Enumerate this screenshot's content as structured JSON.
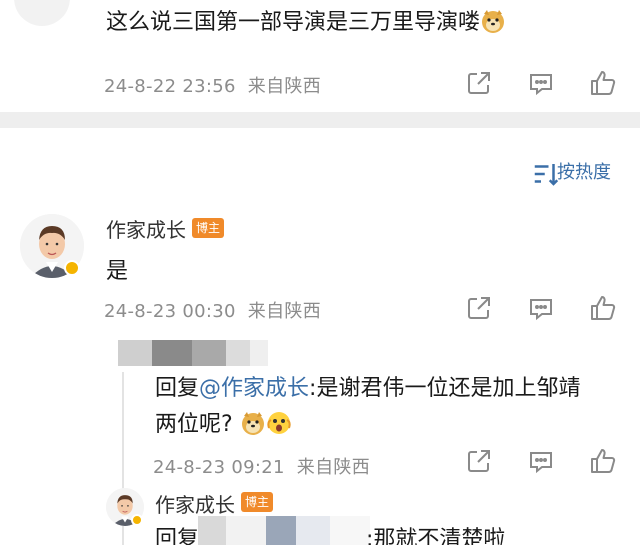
{
  "top_comment": {
    "text": "这么说三国第一部导演是三万里导演喽",
    "emoji_icon": "doge-emoji",
    "time": "24-8-22 23:56",
    "location": "来自陕西"
  },
  "sort": {
    "label": "按热度",
    "icon": "sort-icon"
  },
  "author_comment": {
    "username": "作家成长",
    "badge": "博主",
    "text": "是",
    "time": "24-8-23 00:30",
    "location": "来自陕西"
  },
  "reply_1": {
    "prefix": "回复",
    "mention": "@作家成长",
    "text_line1": ":是谢君伟一位还是加上邹靖",
    "text_line2": "两位呢?",
    "time": "24-8-23 09:21",
    "location": "来自陕西"
  },
  "reply_2": {
    "username": "作家成长",
    "badge": "博主",
    "prefix": "回复",
    "text": ":那就不清楚啦"
  },
  "colors": {
    "link": "#3b6fa8",
    "meta": "#8c8c8c",
    "badge": "#f08a2a",
    "divider": "#eeeeee"
  }
}
